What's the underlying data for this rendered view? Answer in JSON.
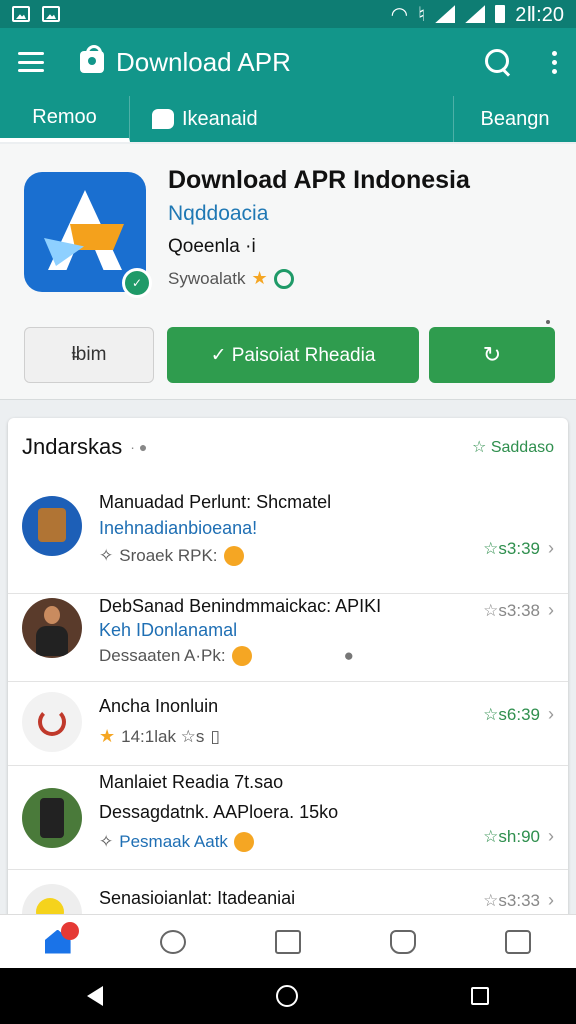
{
  "status_bar": {
    "time": "2Ⅱ:20"
  },
  "app_bar": {
    "title": "Download APR"
  },
  "tabs": [
    {
      "label": "Remoo"
    },
    {
      "label": "Ikeanaid"
    },
    {
      "label": "Beangn"
    }
  ],
  "app": {
    "name": "Download APR Indonesia",
    "subtitle": "Nqddoacia",
    "meta": "Qoeenla  ·i",
    "rating_text": "Sywoalatk",
    "buttons": {
      "secondary": "ƚ̵bim",
      "primary": "✓ Paisoiat Rheadia",
      "refresh": "↻"
    }
  },
  "list": {
    "title": "Jndarskas",
    "title_suffix": "· ●",
    "action": "☆ Saddaso",
    "items": [
      {
        "title": "Manuadad Perlunt: Shcmatel",
        "subtitle": "Inehnadianbioeana!",
        "meta": "Sroaek  RPK:",
        "right": "☆s3:39"
      },
      {
        "title": "DebSanad Benindmmaickac: APIKI",
        "subtitle": "Keh IDonlanamal",
        "meta": "Dessaaten A·Pk:",
        "right": "☆s3:38"
      },
      {
        "title": "Ancha     Inonluin",
        "subtitle": "",
        "meta": "14:1lak  ☆s",
        "right": "☆s6:39"
      },
      {
        "title": "Manlaiet  Readia  7t.sao",
        "subtitle": "Dessagdatnk. AAPloera. 15ko",
        "meta": "Pesmaak  Aatk",
        "right": "☆sh:90"
      },
      {
        "title": "Senasioianlat:  Itadeaniai",
        "subtitle": "",
        "meta": "",
        "right": "☆s3:33"
      }
    ]
  },
  "colors": {
    "app_bar": "#12968a",
    "status_bar": "#0e7d73",
    "accent_green": "#2f9c4e",
    "link_blue": "#1f78b4"
  },
  "icons": {
    "menu": "hamburger-icon",
    "store": "store-bag-icon",
    "search": "search-icon",
    "more": "more-vert-icon"
  }
}
